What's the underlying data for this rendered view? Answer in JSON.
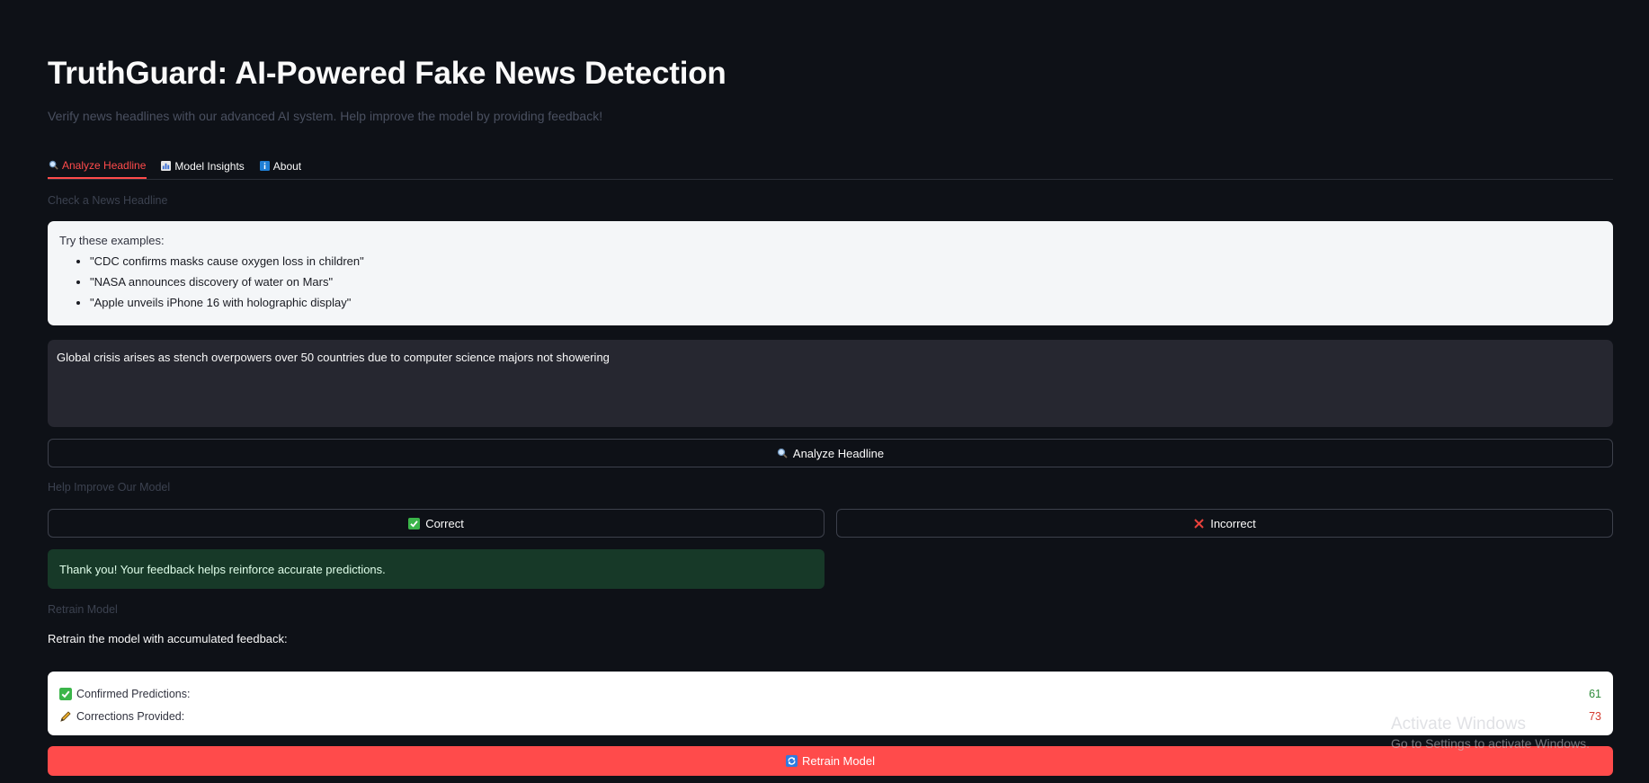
{
  "header": {
    "title": "TruthGuard: AI-Powered Fake News Detection",
    "subtitle": "Verify news headlines with our advanced AI system. Help improve the model by providing feedback!"
  },
  "tabs": [
    {
      "label": "Analyze Headline",
      "icon": "magnifier-icon",
      "active": true
    },
    {
      "label": "Model Insights",
      "icon": "bar-chart-icon",
      "active": false
    },
    {
      "label": "About",
      "icon": "info-icon",
      "active": false
    }
  ],
  "check_section": {
    "label": "Check a News Headline",
    "examples_intro": "Try these examples:",
    "examples": [
      "\"CDC confirms masks cause oxygen loss in children\"",
      "\"NASA announces discovery of water on Mars\"",
      "\"Apple unveils iPhone 16 with holographic display\""
    ],
    "input_value": "Global crisis arises as stench overpowers over 50 countries due to computer science majors not showering",
    "analyze_button": "Analyze Headline"
  },
  "feedback_section": {
    "label": "Help Improve Our Model",
    "correct_button": "Correct",
    "incorrect_button": "Incorrect",
    "success_message": "Thank you! Your feedback helps reinforce accurate predictions."
  },
  "retrain_section": {
    "label": "Retrain Model",
    "description": "Retrain the model with accumulated feedback:",
    "stats": [
      {
        "label": "Confirmed Predictions:",
        "value": "61",
        "icon": "check-mark-icon",
        "color": "#2e8b3a"
      },
      {
        "label": "Corrections Provided:",
        "value": "73",
        "icon": "pencil-icon",
        "color": "#d43a2f"
      }
    ],
    "button": "Retrain Model"
  },
  "watermark": {
    "title": "Activate Windows",
    "subtitle": "Go to Settings to activate Windows."
  },
  "colors": {
    "background": "#0e1117",
    "accent": "#ff4b4b",
    "success_bg": "#173928"
  }
}
